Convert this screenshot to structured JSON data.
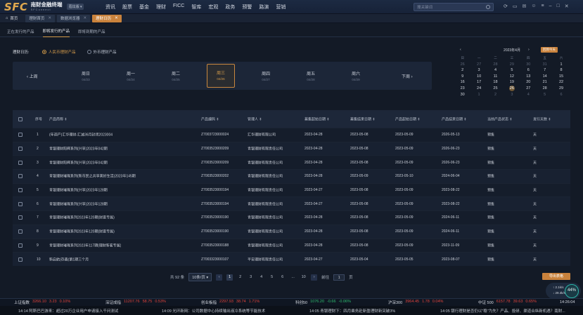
{
  "logo": {
    "mark": "SFC",
    "name_cn": "南财金融终端",
    "name_en": "SFConnect",
    "version": "蔻炫版 ▾"
  },
  "nav": [
    "资讯",
    "股票",
    "基金",
    "理财",
    "FICC",
    "智库",
    "宏观",
    "政务",
    "预警",
    "路演",
    "营销"
  ],
  "search": {
    "placeholder": "搜关键词"
  },
  "toolbar_icons": [
    "refresh-icon",
    "layout-icon",
    "message-icon",
    "user-icon",
    "menu-icon",
    "minimize-icon",
    "maximize-icon",
    "close-icon"
  ],
  "home_tab": "首页",
  "window_tabs": [
    {
      "label": "理财首页",
      "active": false
    },
    {
      "label": "数据浏览器",
      "active": false
    },
    {
      "label": "理财日历",
      "active": true
    }
  ],
  "sub_tabs": [
    {
      "label": "正在发行的产品",
      "active": false
    },
    {
      "label": "即将发行的产品",
      "active": true
    },
    {
      "label": "即将到期的产品",
      "active": false
    }
  ],
  "calendar_filter": {
    "label": "理财日历:",
    "options": [
      {
        "label": "人民币理财产品",
        "selected": true
      },
      {
        "label": "外币理财产品",
        "selected": false
      }
    ]
  },
  "week": {
    "prev": "‹ 上周",
    "next": "下周 ›",
    "days": [
      {
        "name": "周日",
        "date": "04/23",
        "selected": false
      },
      {
        "name": "周一",
        "date": "04/24",
        "selected": false
      },
      {
        "name": "周二",
        "date": "04/25",
        "selected": false
      },
      {
        "name": "周三",
        "date": "04/26",
        "selected": true
      },
      {
        "name": "周四",
        "date": "04/27",
        "selected": false
      },
      {
        "name": "周五",
        "date": "04/28",
        "selected": false
      },
      {
        "name": "周六",
        "date": "04/29",
        "selected": false
      }
    ]
  },
  "mini_calendar": {
    "title": "2023年4月",
    "today_btn": "回到今天",
    "weekdays": [
      "日",
      "一",
      "二",
      "三",
      "四",
      "五",
      "六"
    ],
    "days": [
      {
        "d": "26",
        "off": true
      },
      {
        "d": "27",
        "off": true
      },
      {
        "d": "28",
        "off": true
      },
      {
        "d": "29",
        "off": true
      },
      {
        "d": "30",
        "off": true
      },
      {
        "d": "31",
        "off": true
      },
      {
        "d": "1",
        "off": false
      },
      {
        "d": "2",
        "off": false
      },
      {
        "d": "3",
        "off": false
      },
      {
        "d": "4",
        "off": false
      },
      {
        "d": "5",
        "off": false
      },
      {
        "d": "6",
        "off": false
      },
      {
        "d": "7",
        "off": false
      },
      {
        "d": "8",
        "off": false
      },
      {
        "d": "9",
        "off": false
      },
      {
        "d": "10",
        "off": false
      },
      {
        "d": "11",
        "off": false
      },
      {
        "d": "12",
        "off": false
      },
      {
        "d": "13",
        "off": false
      },
      {
        "d": "14",
        "off": false
      },
      {
        "d": "15",
        "off": false
      },
      {
        "d": "16",
        "off": false
      },
      {
        "d": "17",
        "off": false
      },
      {
        "d": "18",
        "off": false
      },
      {
        "d": "19",
        "off": false
      },
      {
        "d": "20",
        "off": false
      },
      {
        "d": "21",
        "off": false
      },
      {
        "d": "22",
        "off": false
      },
      {
        "d": "23",
        "off": false
      },
      {
        "d": "24",
        "off": false
      },
      {
        "d": "25",
        "off": false
      },
      {
        "d": "26",
        "off": false,
        "sel": true
      },
      {
        "d": "27",
        "off": false
      },
      {
        "d": "28",
        "off": false
      },
      {
        "d": "29",
        "off": false
      },
      {
        "d": "30",
        "off": false
      },
      {
        "d": "1",
        "off": true
      },
      {
        "d": "2",
        "off": true
      },
      {
        "d": "3",
        "off": true
      },
      {
        "d": "4",
        "off": true
      },
      {
        "d": "5",
        "off": true
      },
      {
        "d": "6",
        "off": true
      }
    ]
  },
  "table": {
    "headers": [
      "序号",
      "产品简称 ⇕",
      "产品编码 ⇕",
      "管理人 ⇕",
      "募集起始日期 ⇕",
      "募集结束日期 ⇕",
      "产品起始日期 ⇕",
      "产品结束日期 ⇕",
      "当前产品状态 ⇕",
      "发行天数 ⇕"
    ],
    "rows": [
      [
        "1",
        "(年调产)汇华理财-汇诚36月封闭2023004",
        "Z7003723000024",
        "汇华理财有限公司",
        "2023-04-28",
        "2023-05-08",
        "2023-05-09",
        "2026-05-13",
        "预售",
        "天"
      ],
      [
        "2",
        "青银理财阳辉系列(兴享)2023年042期",
        "Z7003523000209",
        "青银理财有限责任公司",
        "2023-04-28",
        "2023-05-08",
        "2023-05-09",
        "2026-06-23",
        "预售",
        "天"
      ],
      [
        "3",
        "青银理财阳辉系列(兴享)2023年042期",
        "Z7003523000209",
        "青银理财有限责任公司",
        "2023-04-28",
        "2023-05-08",
        "2023-05-09",
        "2026-06-23",
        "预售",
        "天"
      ],
      [
        "4",
        "青银理财璀璨系列(新市民之共享美好生活)2023年145期",
        "Z7003523000202",
        "青银理财有限责任公司",
        "2023-04-28",
        "2023-05-09",
        "2023-05-10",
        "2024-06-04",
        "预售",
        "天"
      ],
      [
        "5",
        "青银理财璀璨系列(兴享)2023年128期",
        "Z7003523000194",
        "青银理财有限责任公司",
        "2023-04-27",
        "2023-05-08",
        "2023-05-09",
        "2023-08-22",
        "预售",
        "天"
      ],
      [
        "6",
        "青银理财璀璨系列(兴享)2023年128期",
        "Z7003523000194",
        "青银理财有限责任公司",
        "2023-04-27",
        "2023-05-08",
        "2023-05-09",
        "2023-08-22",
        "预售",
        "天"
      ],
      [
        "7",
        "青银理财璀璨系列2023年120期(财富专属)",
        "Z7003523000190",
        "青银理财有限责任公司",
        "2023-04-28",
        "2023-05-08",
        "2023-05-09",
        "2024-06-11",
        "预售",
        "天"
      ],
      [
        "8",
        "青银理财璀璨系列2023年120期(财富专属)",
        "Z7003523000190",
        "青银理财有限责任公司",
        "2023-04-28",
        "2023-05-08",
        "2023-05-09",
        "2024-06-11",
        "预售",
        "天"
      ],
      [
        "9",
        "青银理财璀璨系列2023年117期(理财新客专属)",
        "Z7003523000188",
        "青银理财有限责任公司",
        "2023-04-28",
        "2023-05-08",
        "2023-05-09",
        "2023-11-09",
        "预售",
        "天"
      ],
      [
        "10",
        "新启航(存鑫)第1期三个月",
        "Z7003323000107",
        "平安理财有限责任公司",
        "2023-04-27",
        "2023-05-04",
        "2023-05-05",
        "2023-08-07",
        "预售",
        "天"
      ]
    ]
  },
  "pager": {
    "total": "共 92 条",
    "page_size": "10条/页 ▾",
    "pages": [
      "1",
      "2",
      "3",
      "4",
      "5",
      "6",
      "...",
      "10"
    ],
    "current": "1",
    "prev": "‹",
    "next": "›",
    "goto_label": "前往",
    "goto_value": "1",
    "goto_suffix": "页"
  },
  "export_btn": "导出表格",
  "net_widget": {
    "up": "↑ 2.1k/s",
    "down": "↓ 29.3k/s",
    "percent": "44%"
  },
  "ticker": [
    {
      "name": "上证指数",
      "val": "3266.10",
      "chg": "3.23",
      "pct": "0.10%",
      "dir": "up"
    },
    {
      "name": "深证成指",
      "val": "11207.76",
      "chg": "58.75",
      "pct": "0.53%",
      "dir": "up"
    },
    {
      "name": "创业板指",
      "val": "2297.93",
      "chg": "38.74",
      "pct": "1.71%",
      "dir": "up"
    },
    {
      "name": "科创50",
      "val": "1076.20",
      "chg": "-0.66",
      "pct": "-0.06%",
      "dir": "down"
    },
    {
      "name": "沪深300",
      "val": "3964.45",
      "chg": "1.78",
      "pct": "0.04%",
      "dir": "up"
    },
    {
      "name": "中证 500",
      "val": "6157.78",
      "chg": "39.63",
      "pct": "0.65%",
      "dir": "up"
    }
  ],
  "clock": "14:26:04",
  "news": [
    "14:14 阿斯巴巴游来：超过20万企业用户申请接入千问测试",
    "14:09 光环新网：公司数据中心持续输出液冷系统等节能技术",
    "14:05 青银理财下：四月乘务赴新盈理财新突破3%",
    "14:05 银行理财是否仍以\"稳\"为先？产品、投研、渠道合纵新机遇？南财..."
  ],
  "colors": {
    "accent": "#c9823c",
    "up": "#e0433c",
    "down": "#2fbf71",
    "bg": "#131a26"
  }
}
